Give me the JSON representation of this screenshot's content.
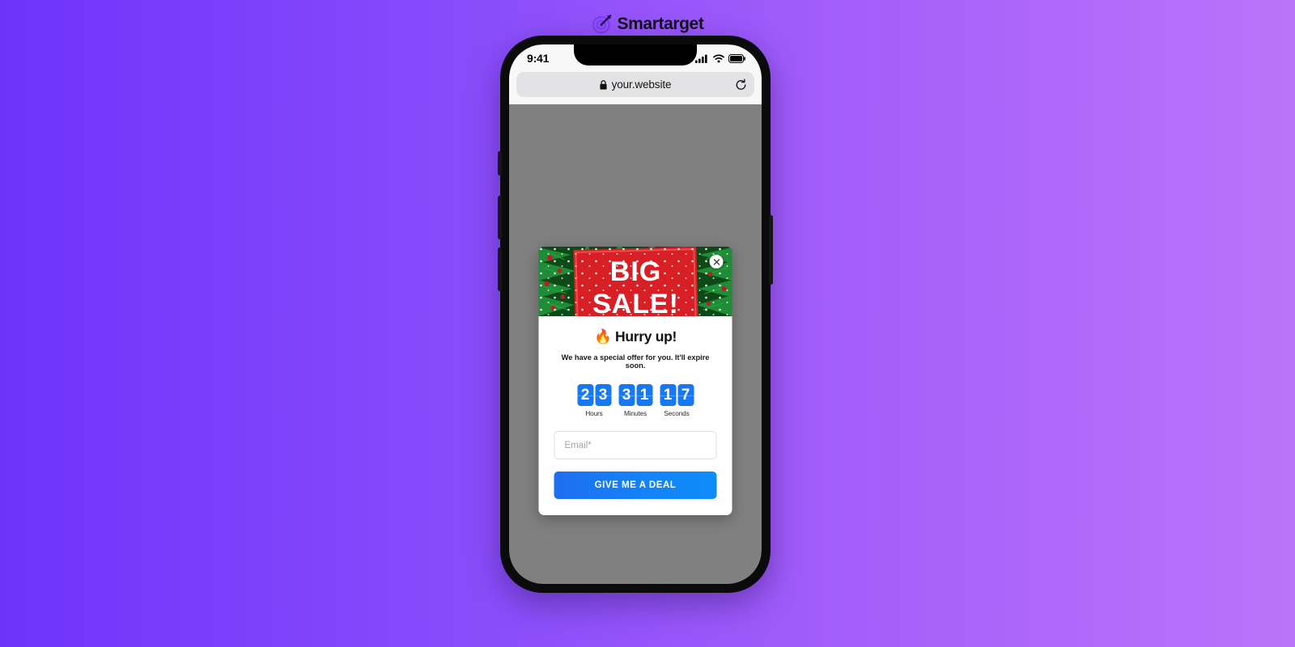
{
  "brand": {
    "name": "Smartarget",
    "logo_icon": "target-arrow-icon",
    "logo_letter": "S",
    "color": "#7b3cf5"
  },
  "background": {
    "gradient_from": "#6e33fb",
    "gradient_to": "#bb73fa"
  },
  "phone": {
    "status_bar": {
      "time": "9:41",
      "signal_icon": "cellular-signal-icon",
      "wifi_icon": "wifi-icon",
      "battery_icon": "battery-icon"
    },
    "browser": {
      "lock_icon": "lock-icon",
      "url": "your.website",
      "reload_icon": "reload-icon"
    },
    "screen_color": "#808080"
  },
  "popup": {
    "hero": {
      "image_alt": "christmas-big-sale-banner",
      "headline_line1": "BIG",
      "headline_line2": "SALE!",
      "sign_color": "#d81f26",
      "foliage_color": "#1f7a35"
    },
    "close_icon": "close-icon",
    "title": "🔥 Hurry up!",
    "subtitle": "We have a special offer for you. It'll expire soon.",
    "countdown": {
      "accent_color": "#1778f2",
      "units": [
        {
          "label": "Hours",
          "value": "23",
          "digits": [
            "2",
            "3"
          ]
        },
        {
          "label": "Minutes",
          "value": "31",
          "digits": [
            "3",
            "1"
          ]
        },
        {
          "label": "Seconds",
          "value": "17",
          "digits": [
            "1",
            "7"
          ]
        }
      ]
    },
    "email_field": {
      "placeholder": "Email*",
      "value": ""
    },
    "cta": {
      "label": "GIVE ME A DEAL",
      "color": "#1383f7"
    }
  }
}
